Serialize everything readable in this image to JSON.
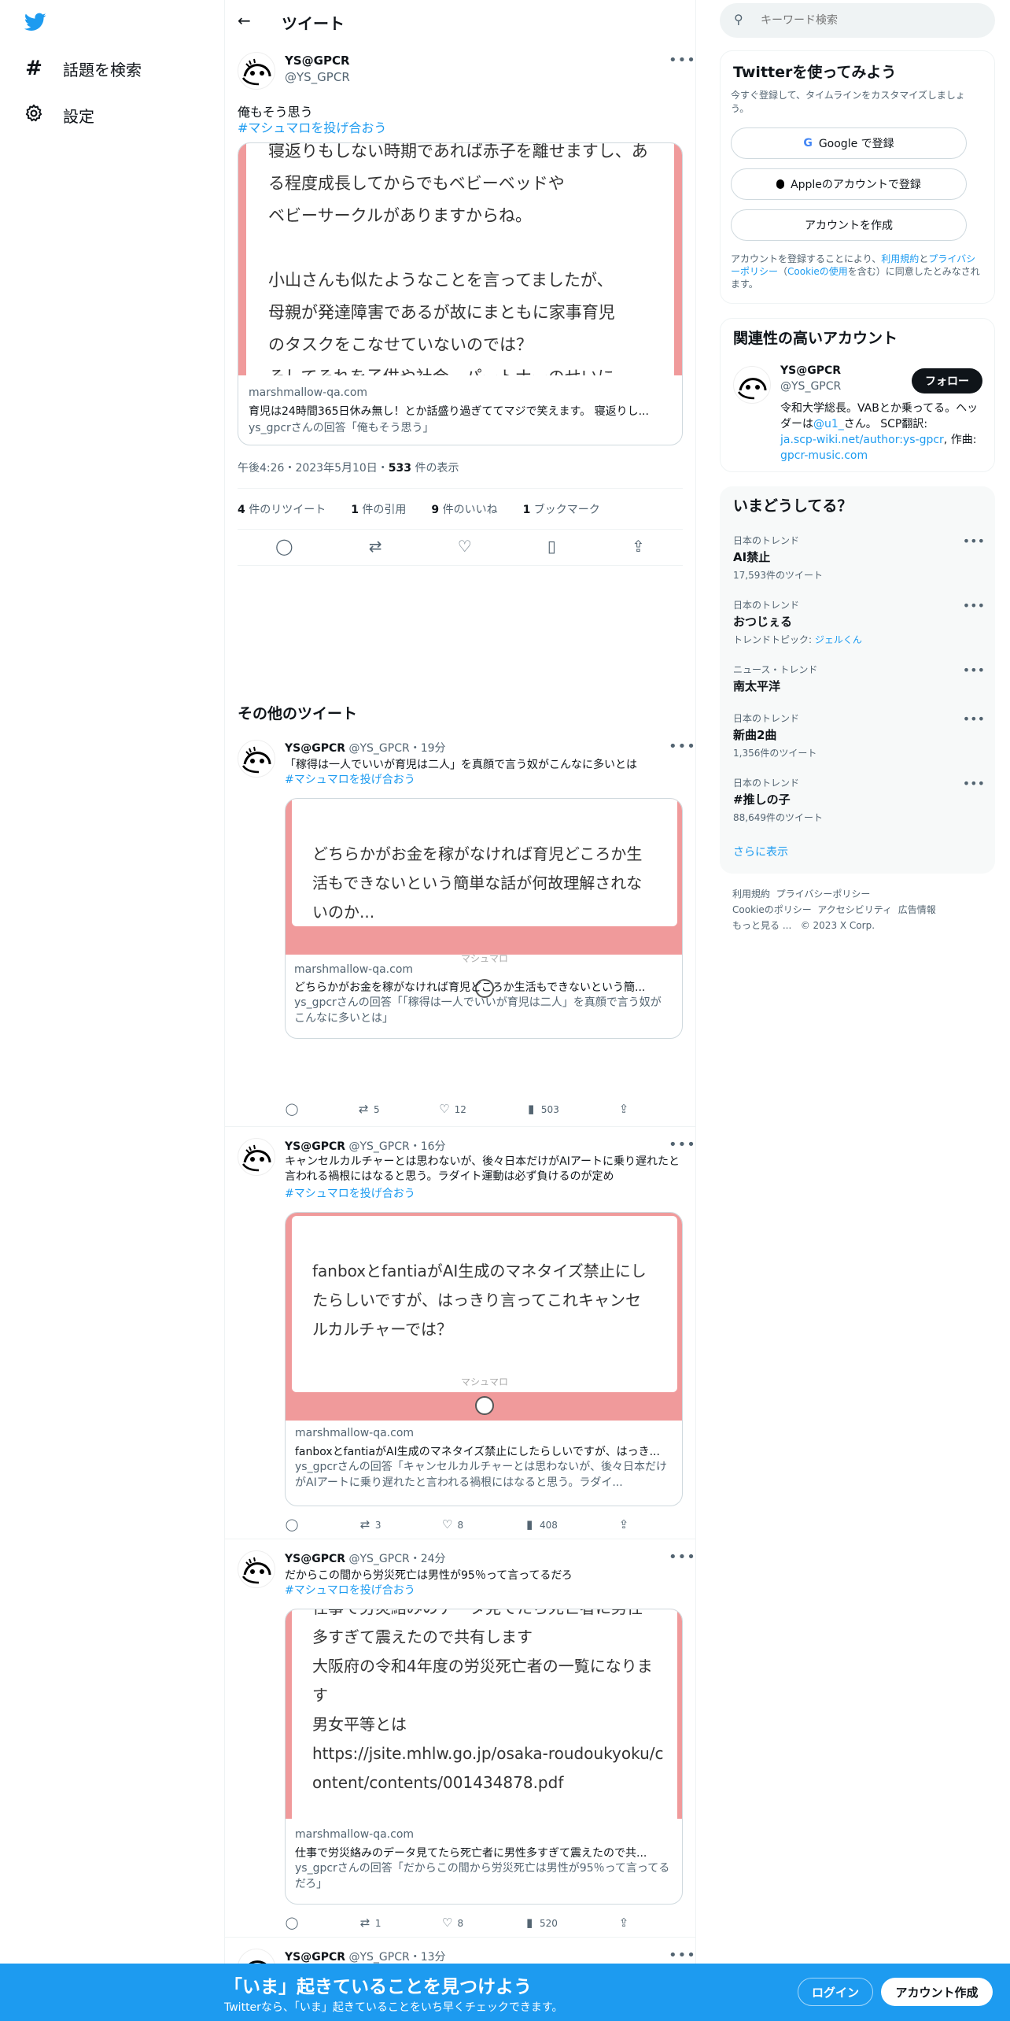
{
  "nav": {
    "explore_label": "話題を検索",
    "settings_label": "設定"
  },
  "header": {
    "title": "ツイート"
  },
  "main_tweet": {
    "name": "YS@GPCR",
    "handle": "@YS_GPCR",
    "text": "俺もそう思う",
    "hashtag": "#マシュマロを投げ合おう",
    "card_lines": [
      "寝返りもしない時期であれば赤子を離せますし、ある程度成長してからでもベビーベッドや",
      "ベビーサークルがありますからね。",
      "",
      "小山さんも似たようなことを言ってましたが、",
      "母親が発達障害であるが故にまともに家事育児",
      "のタスクをこなせていないのでは？",
      "そしてそれを子供や社会、パートナーのせいに"
    ],
    "card_domain": "marshmallow-qa.com",
    "card_title": "育児は24時間365日休み無し！とか話盛り過ぎててマジで笑えます。 寝返りし...",
    "card_desc": "ys_gpcrさんの回答「俺もそう思う」",
    "time": "午後4:26・2023年5月10日・",
    "views_num": "533",
    "views_label": " 件の表示",
    "stats": {
      "retweets_num": "4",
      "retweets_label": " 件のリツイート",
      "quotes_num": "1",
      "quotes_label": " 件の引用",
      "likes_num": "9",
      "likes_label": " 件のいいね",
      "bookmarks_num": "1",
      "bookmarks_label": " ブックマーク"
    }
  },
  "more_tweets_heading": "その他のツイート",
  "tweets": [
    {
      "name": "YS@GPCR",
      "handle": "@YS_GPCR",
      "time": "・19分",
      "text": "「稼得は一人でいいが育児は二人」を真顔で言う奴がこんなに多いとは",
      "hashtag": "#マシュマロを投げ合おう",
      "card_lines": [
        "どちらかがお金を稼がなければ育児どころか生",
        "活もできないという簡単な話が何故理解されな",
        "いのか..."
      ],
      "brand": "マシュマロ",
      "domain": "marshmallow-qa.com",
      "title": "どちらかがお金を稼がなければ育児どころか生活もできないという簡...",
      "desc": "ys_gpcrさんの回答「「稼得は一人でいいが育児は二人」を真顔で言う奴がこんなに多いとは」",
      "retweets": "5",
      "likes": "12",
      "views": "503"
    },
    {
      "name": "YS@GPCR",
      "handle": "@YS_GPCR",
      "time": "・16分",
      "text": "キャンセルカルチャーとは思わないが、後々日本だけがAIアートに乗り遅れたと言われる禍根にはなると思う。ラダイト運動は必ず負けるのが定め",
      "hashtag": "#マシュマロを投げ合おう",
      "card_lines": [
        "fanboxとfantiaがAI生成のマネタイズ禁止にし",
        "たらしいですが、はっきり言ってこれキャンセ",
        "ルカルチャーでは？"
      ],
      "brand": "マシュマロ",
      "domain": "marshmallow-qa.com",
      "title": "fanboxとfantiaがAI生成のマネタイズ禁止にしたらしいですが、はっき...",
      "desc": "ys_gpcrさんの回答「キャンセルカルチャーとは思わないが、後々日本だけがAIアートに乗り遅れたと言われる禍根にはなると思う。ラダイ...",
      "retweets": "3",
      "likes": "8",
      "views": "408"
    },
    {
      "name": "YS@GPCR",
      "handle": "@YS_GPCR",
      "time": "・24分",
      "text": "だからこの間から労災死亡は男性が95％って言ってるだろ",
      "hashtag": "#マシュマロを投げ合おう",
      "card_lines": [
        "仕事で労災絡みのデータ見てたら死亡者に男性",
        "多すぎて震えたので共有します",
        "大阪府の令和4年度の労災死亡者の一覧になりま",
        "す",
        "男女平等とは",
        "https://jsite.mhlw.go.jp/osaka-roudoukyoku/c",
        "ontent/contents/001434878.pdf"
      ],
      "brand": "",
      "domain": "marshmallow-qa.com",
      "title": "仕事で労災絡みのデータ見てたら死亡者に男性多すぎて震えたので共...",
      "desc": "ys_gpcrさんの回答「だからこの間から労災死亡は男性が95％って言ってるだろ」",
      "retweets": "1",
      "likes": "8",
      "views": "520"
    },
    {
      "name": "YS@GPCR",
      "handle": "@YS_GPCR",
      "time": "・13分"
    }
  ],
  "search": {
    "placeholder": "キーワード検索"
  },
  "signup": {
    "title": "Twitterを使ってみよう",
    "subtitle": "今すぐ登録して、タイムラインをカスタマイズしましょう。",
    "google": "Google で登録",
    "apple": "Appleのアカウントで登録",
    "create": "アカウントを作成",
    "legal_prefix": "アカウントを登録することにより、",
    "terms": "利用規約",
    "and": "と",
    "privacy": "プライバシーポリシー",
    "cookie_open": "（",
    "cookie": "Cookieの使用",
    "legal_suffix": "を含む）に同意したとみなされます。"
  },
  "related": {
    "title": "関連性の高いアカウント",
    "name": "YS@GPCR",
    "handle": "@YS_GPCR",
    "follow": "フォロー",
    "bio1": "令和大学総長。VABとか乗ってる。ヘッダーは",
    "bio_link1": "@u1_",
    "bio2": "さん。 SCP翻訳:",
    "bio_link2": "ja.scp-wiki.net/author:ys-gpcr",
    "bio3": ", 作曲:",
    "bio_link3": "gpcr-music.com"
  },
  "trends": {
    "title": "いまどうしてる？",
    "items": [
      {
        "category": "日本のトレンド",
        "name": "AI禁止",
        "count": "17,593件のツイート"
      },
      {
        "category": "日本のトレンド",
        "name": "おつじぇる",
        "count_prefix": "トレンドトピック: ",
        "count_link": "ジェルくん"
      },
      {
        "category": "ニュース・トレンド",
        "name": "南太平洋"
      },
      {
        "category": "日本のトレンド",
        "name": "新曲2曲",
        "count": "1,356件のツイート"
      },
      {
        "category": "日本のトレンド",
        "name": "#推しの子",
        "count": "88,649件のツイート"
      }
    ],
    "more": "さらに表示"
  },
  "footer": {
    "links": [
      "利用規約",
      "プライバシーポリシー",
      "Cookieのポリシー",
      "アクセシビリティ",
      "広告情報",
      "もっと見る ...",
      "© 2023 X Corp."
    ]
  },
  "bottom_bar": {
    "title": "「いま」起きていることを見つけよう",
    "subtitle": "Twitterなら、「いま」起きていることをいち早くチェックできます。",
    "login": "ログイン",
    "signup": "アカウント作成"
  },
  "colors": {
    "accent": "#1d9bf0",
    "card_pink": "#f09a9b"
  }
}
